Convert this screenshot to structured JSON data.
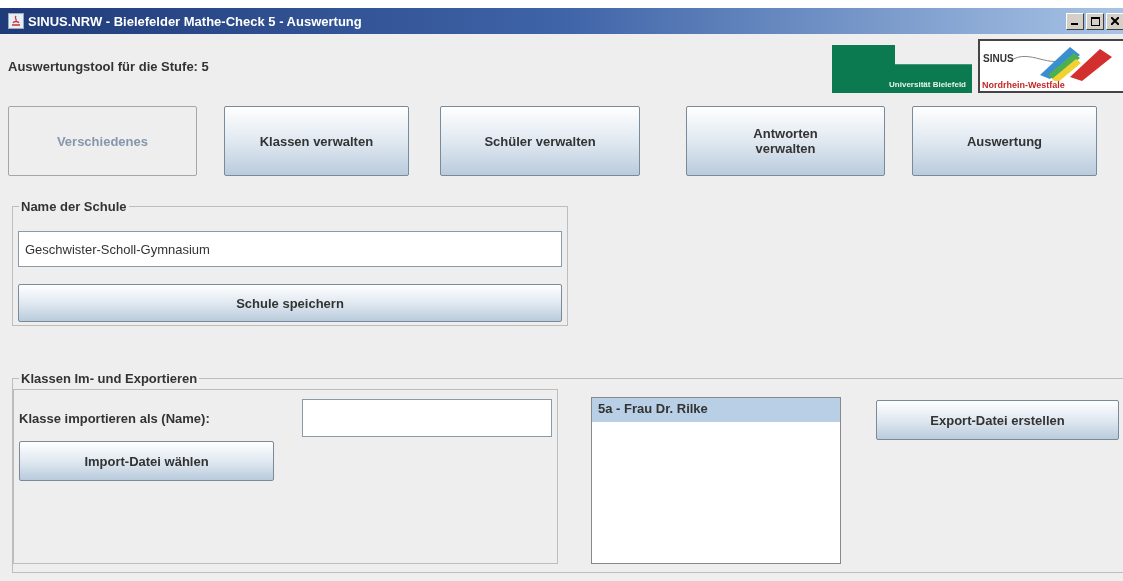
{
  "window": {
    "title": "SINUS.NRW - Bielefelder Mathe-Check 5 - Auswertung"
  },
  "header": {
    "label": "Auswertungstool für die Stufe: 5",
    "logo_university": "Universität Bielefeld",
    "logo_sinus": "SINUS",
    "logo_region": "Nordrhein-Westfale"
  },
  "nav_buttons": [
    {
      "label": "Verschiedenes",
      "disabled": true
    },
    {
      "label": "Klassen verwalten",
      "disabled": false
    },
    {
      "label": "Schüler verwalten",
      "disabled": false
    },
    {
      "label": "Antworten verwalten",
      "disabled": false
    },
    {
      "label": "Auswertung",
      "disabled": false
    }
  ],
  "school": {
    "legend": "Name der Schule",
    "value": "Geschwister-Scholl-Gymnasium",
    "button": "Schule speichern"
  },
  "import_export": {
    "legend": "Klassen Im- und Exportieren",
    "import_label": "Klasse importieren als (Name):",
    "import_button": "Import-Datei wählen",
    "classes": [
      {
        "label": "5a - Frau Dr. Rilke",
        "selected": true
      }
    ],
    "export_button": "Export-Datei erstellen"
  }
}
